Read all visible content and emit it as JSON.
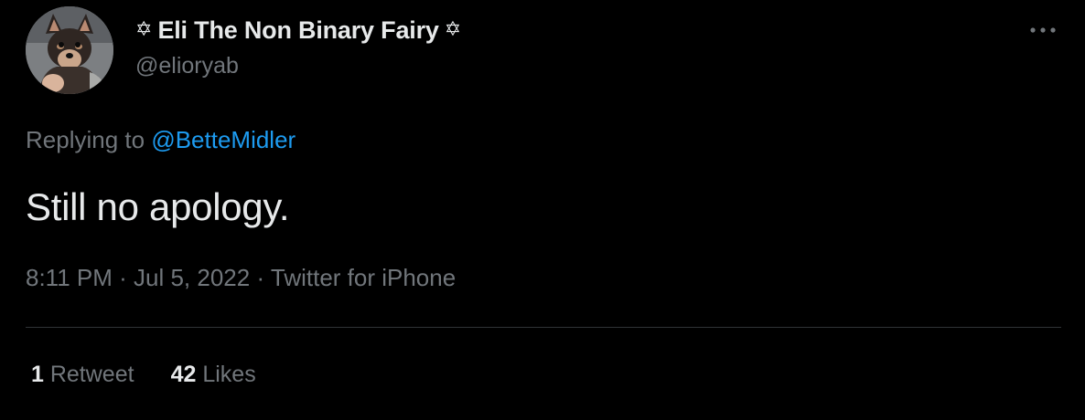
{
  "author": {
    "display_name": "Eli The Non Binary Fairy",
    "name_prefix_symbol": "✡",
    "name_suffix_symbol": "✡",
    "handle": "@elioryab",
    "avatar_icon": "dog-avatar"
  },
  "menu": {
    "more_icon": "more-horizontal-icon"
  },
  "reply": {
    "prefix": "Replying to ",
    "mention": "@BetteMidler"
  },
  "tweet": {
    "text": "Still no apology."
  },
  "meta": {
    "time": "8:11 PM",
    "sep1": " · ",
    "date": "Jul 5, 2022",
    "sep2": " · ",
    "source": "Twitter for iPhone"
  },
  "stats": {
    "retweets_count": "1",
    "retweets_label": " Retweet",
    "likes_count": "42",
    "likes_label": " Likes"
  },
  "colors": {
    "background": "#000000",
    "primary_text": "#e7e9ea",
    "secondary_text": "#71767b",
    "link": "#1d9bf0",
    "divider": "#2f3336"
  }
}
